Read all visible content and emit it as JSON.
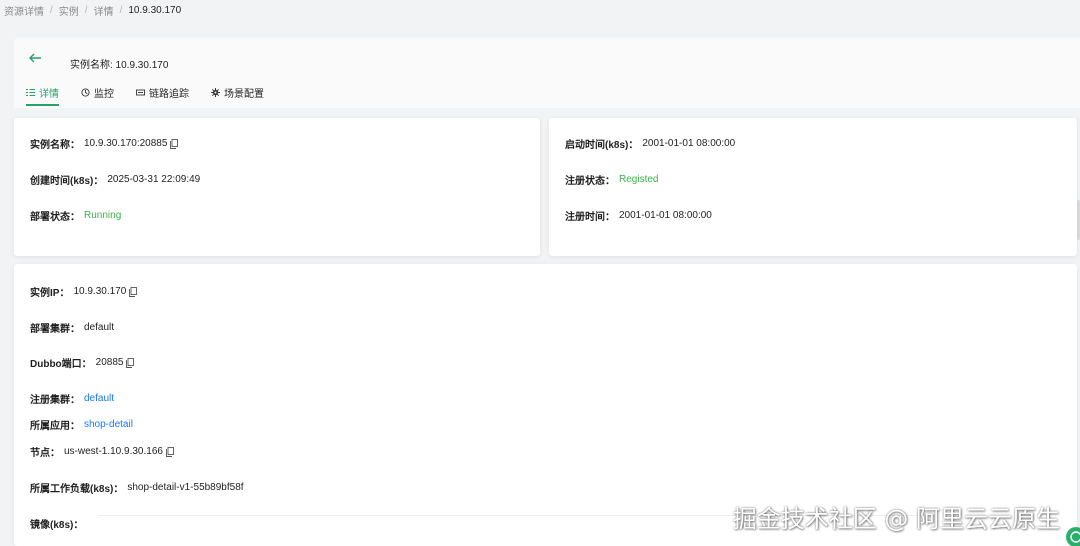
{
  "breadcrumb": {
    "items": [
      "资源详情",
      "实例",
      "详情"
    ],
    "current": "10.9.30.170",
    "separator": "/"
  },
  "header": {
    "title": "实例名称: 10.9.30.170"
  },
  "tabs": [
    {
      "label": "详情",
      "icon": "list-icon",
      "active": true
    },
    {
      "label": "监控",
      "icon": "monitor-icon",
      "active": false
    },
    {
      "label": "链路追踪",
      "icon": "trace-icon",
      "active": false
    },
    {
      "label": "场景配置",
      "icon": "gear-icon",
      "active": false
    }
  ],
  "left_card": {
    "instance_name_label": "实例名称：",
    "instance_name_value": "10.9.30.170:20885",
    "create_time_label": "创建时间(k8s)：",
    "create_time_value": "2025-03-31 22:09:49",
    "deploy_status_label": "部署状态：",
    "deploy_status_value": "Running"
  },
  "right_card": {
    "start_time_label": "启动时间(k8s)：",
    "start_time_value": "2001-01-01 08:00:00",
    "register_status_label": "注册状态：",
    "register_status_value": "Registed",
    "register_time_label": "注册时间：",
    "register_time_value": "2001-01-01 08:00:00"
  },
  "detail_card": {
    "ip_label": "实例IP：",
    "ip_value": "10.9.30.170",
    "cluster_label": "部署集群：",
    "cluster_value": "default",
    "dubbo_port_label": "Dubbo端口：",
    "dubbo_port_value": "20885",
    "register_cluster_label": "注册集群：",
    "register_cluster_value": "default",
    "app_label": "所属应用：",
    "app_value": "shop-detail",
    "node_label": "节点：",
    "node_value": "us-west-1.10.9.30.166",
    "workload_label": "所属工作负载(k8s)：",
    "workload_value": "shop-detail-v1-55b89bf58f",
    "image_label": "镜像(k8s)："
  },
  "watermark": "掘金技术社区 @ 阿里云云原生",
  "colors": {
    "accent": "#27a06a",
    "status_green": "#3bb34a",
    "link_blue": "#1677ff"
  }
}
